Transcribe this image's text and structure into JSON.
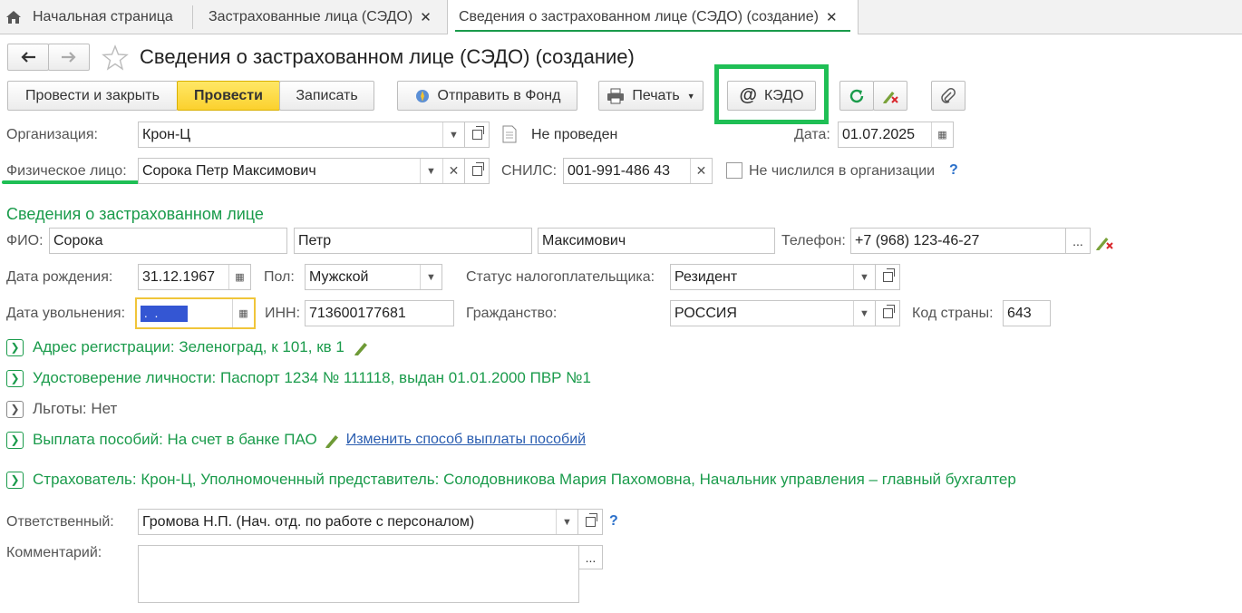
{
  "tabs": {
    "home": "Начальная страница",
    "insured": "Застрахованные лица (СЭДО)",
    "current": "Сведения о застрахованном лице (СЭДО) (создание)"
  },
  "header": {
    "title": "Сведения о застрахованном лице (СЭДО) (создание)"
  },
  "toolbar": {
    "post_close": "Провести и закрыть",
    "post": "Провести",
    "save": "Записать",
    "send_fund": "Отправить в Фонд",
    "print": "Печать",
    "kedo": "КЭДО",
    "highlight_color": "#1fbf55"
  },
  "form": {
    "org_label": "Организация:",
    "org_value": "Крон-Ц",
    "status_text": "Не проведен",
    "date_label": "Дата:",
    "date_value": "01.07.2025",
    "person_label": "Физическое лицо:",
    "person_value": "Сорока Петр Максимович",
    "snils_label": "СНИЛС:",
    "snils_value": "001-991-486 43",
    "not_employed_label": "Не числился в организации",
    "help": "?"
  },
  "insured": {
    "section_title": "Сведения о застрахованном лице",
    "fio_label": "ФИО:",
    "last_name": "Сорока",
    "first_name": "Петр",
    "middle_name": "Максимович",
    "phone_label": "Телефон:",
    "phone_value": "+7 (968) 123-46-27",
    "birth_label": "Дата рождения:",
    "birth_value": "31.12.1967",
    "sex_label": "Пол:",
    "sex_value": "Мужской",
    "tax_status_label": "Статус налогоплательщика:",
    "tax_status_value": "Резидент",
    "dismissal_label": "Дата увольнения:",
    "dismissal_value": " .  .",
    "inn_label": "ИНН:",
    "inn_value": "713600177681",
    "citizenship_label": "Гражданство:",
    "citizenship_value": "РОССИЯ",
    "country_code_label": "Код страны:",
    "country_code_value": "643"
  },
  "sections": {
    "address": "Адрес регистрации: Зеленоград, к 101, кв 1",
    "identity": "Удостоверение личности: Паспорт 1234 № 111118, выдан 01.01.2000 ПВР №1",
    "benefits": "Льготы: Нет",
    "payment": "Выплата пособий: На счет в банке ПАО",
    "payment_link": "Изменить способ выплаты пособий",
    "insurer": "Страхователь: Крон-Ц, Уполномоченный представитель: Солодовникова Мария Пахомовна, Начальник управления – главный бухгалтер"
  },
  "footer": {
    "responsible_label": "Ответственный:",
    "responsible_value": "Громова Н.П. (Нач. отд. по работе с персоналом)",
    "comment_label": "Комментарий:",
    "comment_value": ""
  }
}
